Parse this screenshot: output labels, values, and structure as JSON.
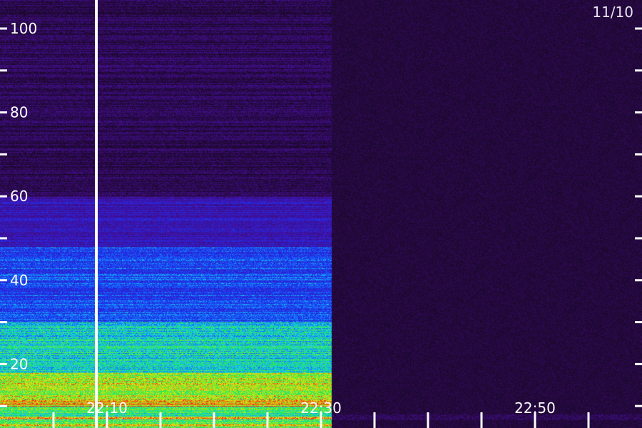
{
  "chart_data": {
    "type": "heatmap",
    "date_label": "11/10",
    "y_ticks": [
      0,
      10,
      20,
      30,
      40,
      50,
      60,
      70,
      80,
      90,
      100
    ],
    "y_tick_labels": [
      {
        "value": 20,
        "label": "20"
      },
      {
        "value": 40,
        "label": "40"
      },
      {
        "value": 60,
        "label": "60"
      },
      {
        "value": 80,
        "label": "80"
      },
      {
        "value": 100,
        "label": "100"
      }
    ],
    "ylim": [
      -5,
      105
    ],
    "x_tick_labels": [
      {
        "value": "22:10",
        "label": "22:10"
      },
      {
        "value": "22:30",
        "label": "22:30"
      },
      {
        "value": "22:50",
        "label": "22:50"
      }
    ],
    "x_minor_ticks": [
      "22:05",
      "22:10",
      "22:15",
      "22:20",
      "22:25",
      "22:30",
      "22:35",
      "22:40",
      "22:45",
      "22:50",
      "22:55"
    ],
    "xlim": [
      "22:00",
      "23:00"
    ],
    "data_end_time": "22:31",
    "marker_time": "22:09",
    "band_profile": [
      {
        "y_top": 100,
        "y_bottom": 60,
        "intensity": 0.1
      },
      {
        "y_top": 60,
        "y_bottom": 48,
        "intensity": 0.3
      },
      {
        "y_top": 48,
        "y_bottom": 30,
        "intensity": 0.48
      },
      {
        "y_top": 30,
        "y_bottom": 18,
        "intensity": 0.66
      },
      {
        "y_top": 18,
        "y_bottom": 10,
        "intensity": 0.85
      },
      {
        "y_top": 10,
        "y_bottom": 4,
        "intensity": 0.74
      }
    ],
    "colors": {
      "background": "#1a0a2a",
      "grid_ticks": "#ffffff",
      "marker": "#ffffff"
    }
  }
}
